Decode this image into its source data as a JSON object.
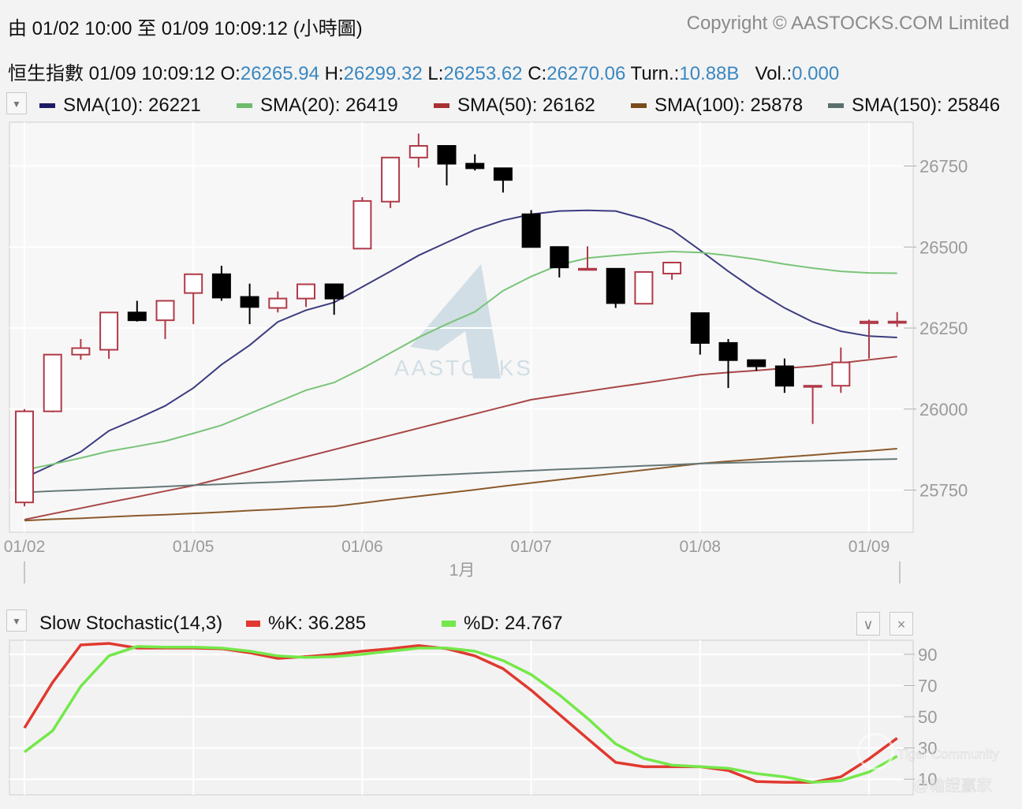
{
  "header": {
    "range_text": "由  01/02 10:00 至  01/09 10:09:12 (小時圖)",
    "copyright": "Copyright © AASTOCKS.COM Limited"
  },
  "quote": {
    "name": "恒生指數",
    "time": "01/09 10:09:12",
    "o_label": "O:",
    "o": "26265.94",
    "h_label": "H:",
    "h": "26299.32",
    "l_label": "L:",
    "l": "26253.62",
    "c_label": "C:",
    "c": "26270.06",
    "turn_label": "Turn.:",
    "turn": "10.88B",
    "vol_label": "Vol.:",
    "vol": "0.000"
  },
  "legend": [
    {
      "label": "SMA(10): 26221",
      "color": "#1c1c66"
    },
    {
      "label": "SMA(20): 26419",
      "color": "#6dbb6d"
    },
    {
      "label": "SMA(50): 26162",
      "color": "#a83232"
    },
    {
      "label": "SMA(100): 25878",
      "color": "#7a4a1a"
    },
    {
      "label": "SMA(150): 25846",
      "color": "#5a6e6e"
    }
  ],
  "watermarks": {
    "logo": "AASTOCKS",
    "tiger": "Tiger Community",
    "author": "@輪證贏家"
  },
  "colors": {
    "up": "#b03a48",
    "down": "#000000",
    "k": "#e0392f",
    "d": "#74e84a"
  },
  "chart_data": [
    {
      "type": "candlestick",
      "x_tick_labels": [
        "01/02",
        "01/05",
        "01/06",
        "01/07",
        "01/08",
        "01/09"
      ],
      "x_tick_index": [
        0,
        6,
        12,
        18,
        24,
        30
      ],
      "month_label": "1月",
      "y_ticks": [
        25750,
        26000,
        26250,
        26500,
        26750
      ],
      "ylim": [
        25620,
        26885
      ],
      "candles_ohlc": [
        [
          25712,
          26000,
          25700,
          25993
        ],
        [
          25993,
          26170,
          25990,
          26168
        ],
        [
          26168,
          26216,
          26152,
          26188
        ],
        [
          26183,
          26300,
          26155,
          26298
        ],
        [
          26298,
          26334,
          26270,
          26274
        ],
        [
          26274,
          26336,
          26216,
          26334
        ],
        [
          26358,
          26418,
          26262,
          26416
        ],
        [
          26416,
          26442,
          26334,
          26344
        ],
        [
          26346,
          26387,
          26262,
          26315
        ],
        [
          26312,
          26363,
          26298,
          26341
        ],
        [
          26341,
          26387,
          26315,
          26385
        ],
        [
          26385,
          26387,
          26291,
          26341
        ],
        [
          26495,
          26654,
          26493,
          26642
        ],
        [
          26640,
          26778,
          26620,
          26776
        ],
        [
          26776,
          26850,
          26745,
          26812
        ],
        [
          26812,
          26814,
          26690,
          26757
        ],
        [
          26757,
          26786,
          26736,
          26743
        ],
        [
          26743,
          26745,
          26668,
          26707
        ],
        [
          26601,
          26614,
          26498,
          26500
        ],
        [
          26500,
          26502,
          26406,
          26437
        ],
        [
          26430,
          26502,
          26428,
          26433
        ],
        [
          26433,
          26435,
          26312,
          26327
        ],
        [
          26325,
          26425,
          26323,
          26423
        ],
        [
          26418,
          26452,
          26399,
          26452
        ],
        [
          26296,
          26298,
          26168,
          26204
        ],
        [
          26204,
          26216,
          26065,
          26151
        ],
        [
          26151,
          26153,
          26118,
          26132
        ],
        [
          26132,
          26156,
          26050,
          26072
        ],
        [
          26070,
          26072,
          25954,
          26072
        ],
        [
          26072,
          26190,
          26050,
          26144
        ],
        [
          26265,
          26276,
          26156,
          26270
        ],
        [
          26265.94,
          26299.32,
          26253.62,
          26270.06
        ]
      ],
      "series": [
        {
          "name": "SMA(10)",
          "color": "#3c3c80",
          "values": [
            25788,
            25828,
            25868,
            25933,
            25970,
            26010,
            26065,
            26137,
            26197,
            26269,
            26305,
            26329,
            26377,
            26425,
            26474,
            26514,
            26553,
            26582,
            26601,
            26611,
            26613,
            26611,
            26587,
            26553,
            26490,
            26425,
            26365,
            26312,
            26269,
            26240,
            26225,
            26221
          ]
        },
        {
          "name": "SMA(20)",
          "color": "#79c479",
          "values": [
            25812,
            25830,
            25849,
            25870,
            25885,
            25901,
            25925,
            25950,
            25986,
            26022,
            26058,
            26082,
            26125,
            26173,
            26221,
            26262,
            26300,
            26365,
            26409,
            26445,
            26466,
            26474,
            26481,
            26486,
            26483,
            26474,
            26462,
            26447,
            26435,
            26425,
            26420,
            26419
          ]
        },
        {
          "name": "SMA(50)",
          "color": "#a84646",
          "values": [
            25659,
            25677,
            25694,
            25712,
            25729,
            25747,
            25764,
            25786,
            25808,
            25831,
            25853,
            25875,
            25897,
            25919,
            25941,
            25963,
            25985,
            26007,
            26029,
            26042,
            26055,
            26068,
            26080,
            26093,
            26106,
            26113,
            26119,
            26126,
            26132,
            26142,
            26152,
            26162
          ]
        },
        {
          "name": "SMA(100)",
          "color": "#8b5a2b",
          "values": [
            25656,
            25660,
            25663,
            25667,
            25671,
            25674,
            25678,
            25682,
            25687,
            25691,
            25696,
            25700,
            25710,
            25721,
            25731,
            25741,
            25751,
            25762,
            25772,
            25782,
            25792,
            25802,
            25812,
            25822,
            25832,
            25839,
            25845,
            25852,
            25858,
            25865,
            25871,
            25878
          ]
        },
        {
          "name": "SMA(150)",
          "color": "#667777",
          "values": [
            25743,
            25747,
            25750,
            25754,
            25757,
            25761,
            25765,
            25768,
            25772,
            25775,
            25779,
            25782,
            25786,
            25790,
            25794,
            25798,
            25802,
            25806,
            25810,
            25814,
            25817,
            25821,
            25825,
            25828,
            25832,
            25834,
            25836,
            25838,
            25840,
            25842,
            25844,
            25846
          ]
        }
      ]
    },
    {
      "type": "line",
      "title": "Slow Stochastic(14,3)",
      "y_ticks": [
        10,
        30,
        50,
        70,
        90
      ],
      "ylim": [
        0,
        99
      ],
      "series": [
        {
          "name": "%K: 36.285",
          "color": "#e0392f",
          "values": [
            42.8,
            72,
            96,
            97,
            94,
            94,
            94,
            93.6,
            91,
            87.4,
            88.5,
            90,
            92,
            93.6,
            95.6,
            93.6,
            89,
            80.8,
            67,
            51.5,
            36,
            20.8,
            18,
            18,
            18,
            15.6,
            8.5,
            8,
            8,
            11.5,
            23,
            36.285
          ]
        },
        {
          "name": "%D: 24.767",
          "color": "#74e84a",
          "values": [
            27.4,
            41,
            69.5,
            89,
            95,
            94.6,
            94.6,
            94,
            92,
            89,
            88,
            88.5,
            90,
            92,
            94,
            94,
            92,
            86,
            77,
            64,
            49,
            32.6,
            23.3,
            19,
            18,
            17,
            13.6,
            11.5,
            8,
            9,
            14.6,
            24.767
          ]
        }
      ]
    }
  ]
}
